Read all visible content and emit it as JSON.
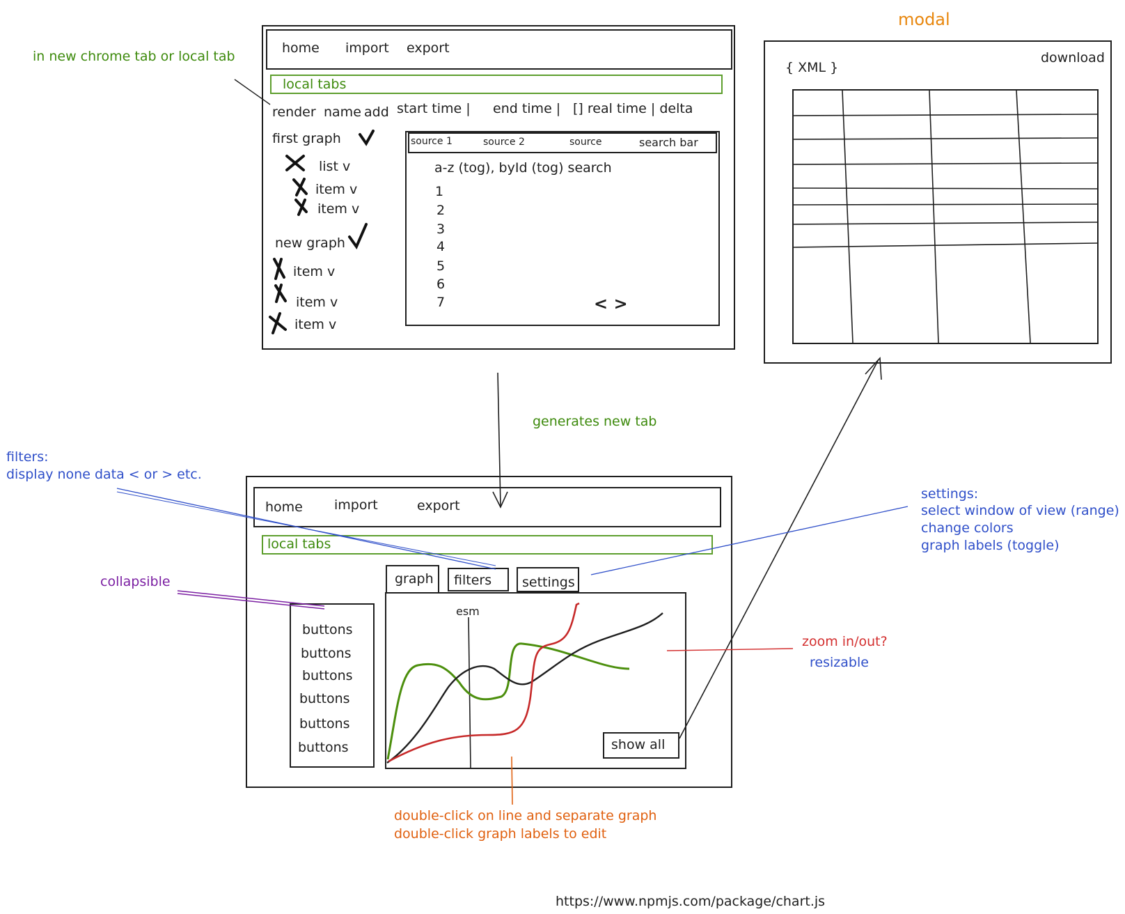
{
  "annotations": {
    "new_tab_note": "in new chrome tab or local tab",
    "generates": "generates new tab",
    "filters_title": "filters:",
    "filters_desc": "display none data < or > etc.",
    "settings_title": "settings:",
    "settings_l1": "select window of view (range)",
    "settings_l2": "change colors",
    "settings_l3": "graph labels (toggle)",
    "collapsible": "collapsible",
    "zoom": "zoom in/out?",
    "resizable": "resizable",
    "dbl1": "double-click on line and separate graph",
    "dbl2": "double-click graph labels to edit",
    "url": "https://www.npmjs.com/package/chart.js",
    "modal_title": "modal"
  },
  "top_window": {
    "nav": [
      "home",
      "import",
      "export"
    ],
    "local_tabs": "local tabs",
    "cols": {
      "render": "render",
      "name": "name",
      "add": "add",
      "start": "start time |",
      "end": "end time |",
      "realtime": "[] real time | delta"
    },
    "tree": {
      "first_graph": "first graph",
      "list": "list v",
      "item1": "item v",
      "item2": "item v",
      "new_graph": "new graph",
      "item3": "item v",
      "item4": "item v",
      "item5": "item v"
    },
    "sources": {
      "s1": "source 1",
      "s2": "source 2",
      "s3": "source",
      "search": "search bar"
    },
    "sort_line": "a-z (tog), byId (tog)  search",
    "rows": [
      "1",
      "2",
      "3",
      "4",
      "5",
      "6",
      "7"
    ],
    "pager": "< >"
  },
  "bottom_window": {
    "nav": [
      "home",
      "import",
      "export"
    ],
    "local_tabs": "local tabs",
    "tabs": [
      "graph",
      "filters",
      "settings"
    ],
    "buttons": [
      "buttons",
      "buttons",
      "buttons",
      "buttons",
      "buttons",
      "buttons"
    ],
    "graph_label": "esm",
    "show_all": "show all"
  },
  "modal": {
    "xml": "{ XML }",
    "download": "download",
    "table_rows": 8,
    "table_cols": 4
  },
  "colors": {
    "annotation_green": "#3d8a0c",
    "annotation_blue": "#2f4fc9",
    "annotation_purple": "#7b1fa2",
    "annotation_red": "#d32f2f",
    "annotation_orange": "#e0600f",
    "line_green": "#4c8f0d",
    "line_red": "#c62828",
    "line_black": "#1e1e1e"
  }
}
